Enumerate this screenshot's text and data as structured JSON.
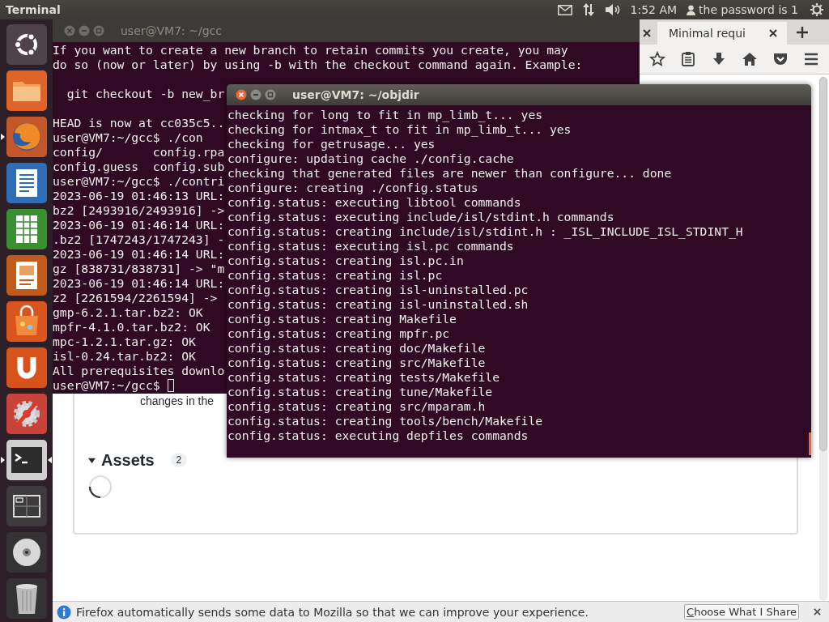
{
  "top_bar": {
    "app_title": "Terminal",
    "clock": "1:52 AM",
    "user": "the password is 1"
  },
  "launcher": [
    {
      "kind": "ubuntu",
      "running": false,
      "focused": false
    },
    {
      "kind": "files",
      "running": false,
      "focused": false
    },
    {
      "kind": "firefox",
      "running": true,
      "focused": false
    },
    {
      "kind": "writer",
      "running": false,
      "focused": false
    },
    {
      "kind": "calc",
      "running": false,
      "focused": false
    },
    {
      "kind": "impress",
      "running": false,
      "focused": false
    },
    {
      "kind": "software",
      "running": false,
      "focused": false
    },
    {
      "kind": "cloud",
      "running": false,
      "focused": false
    },
    {
      "kind": "settings",
      "running": false,
      "focused": false
    },
    {
      "kind": "terminal",
      "running": true,
      "focused": true
    },
    {
      "kind": "workspaces",
      "running": false,
      "focused": false
    },
    {
      "kind": "disc",
      "running": false,
      "focused": false
    },
    {
      "kind": "trash",
      "running": false,
      "focused": false
    }
  ],
  "browser": {
    "tabs": [
      {
        "selected": false
      },
      {
        "title": "Minimal requi",
        "selected": true
      }
    ],
    "page": {
      "text_fragment": "changes in the",
      "section": {
        "title": "Assets",
        "count": "2",
        "expanded": true,
        "loading": true
      }
    },
    "notification": {
      "message": "Firefox automatically sends some data to Mozilla so that we can improve your experience.",
      "button": "Choose What I Share"
    }
  },
  "windows": [
    {
      "title": "user@VM7: ~/gcc",
      "focused": false,
      "cursor": true,
      "blocks": [
        [
          "If you want to create a new branch to retain commits you create, you may",
          "do so (now or later) by using -b with the checkout command again. Example:"
        ],
        [
          "  git checkout -b new_br"
        ],
        [
          "HEAD is now at cc035c5..",
          "user@VM7:~/gcc$ ./con",
          "config/       config.rpa",
          "config.guess  config.sub",
          "user@VM7:~/gcc$ ./contri",
          "2023-06-19 01:46:13 URL:",
          "bz2 [2493916/2493916] ->",
          "2023-06-19 01:46:14 URL:",
          ".bz2 [1747243/1747243] -",
          "2023-06-19 01:46:14 URL:",
          "gz [838731/838731] -> \"m",
          "2023-06-19 01:46:14 URL:",
          "z2 [2261594/2261594] ->",
          "gmp-6.2.1.tar.bz2: OK",
          "mpfr-4.1.0.tar.bz2: OK",
          "mpc-1.2.1.tar.gz: OK",
          "isl-0.24.tar.bz2: OK",
          "All prerequisites downlo",
          "user@VM7:~/gcc$"
        ]
      ]
    },
    {
      "title": "user@VM7: ~/objdir",
      "focused": true,
      "cursor": false,
      "blocks": [
        [
          "checking for long to fit in mp_limb_t... yes",
          "checking for intmax_t to fit in mp_limb_t... yes",
          "checking for getrusage... yes",
          "configure: updating cache ./config.cache",
          "checking that generated files are newer than configure... done",
          "configure: creating ./config.status",
          "config.status: executing libtool commands",
          "config.status: executing include/isl/stdint.h commands",
          "config.status: creating include/isl/stdint.h : _ISL_INCLUDE_ISL_STDINT_H",
          "config.status: executing isl.pc commands",
          "config.status: creating isl.pc.in",
          "config.status: creating isl.pc",
          "config.status: creating isl-uninstalled.pc",
          "config.status: creating isl-uninstalled.sh",
          "config.status: creating Makefile",
          "config.status: creating mpfr.pc",
          "config.status: creating doc/Makefile",
          "config.status: creating src/Makefile",
          "config.status: creating tests/Makefile",
          "config.status: creating tune/Makefile",
          "config.status: creating src/mparam.h",
          "config.status: creating tools/bench/Makefile",
          "config.status: executing depfiles commands"
        ]
      ]
    }
  ]
}
